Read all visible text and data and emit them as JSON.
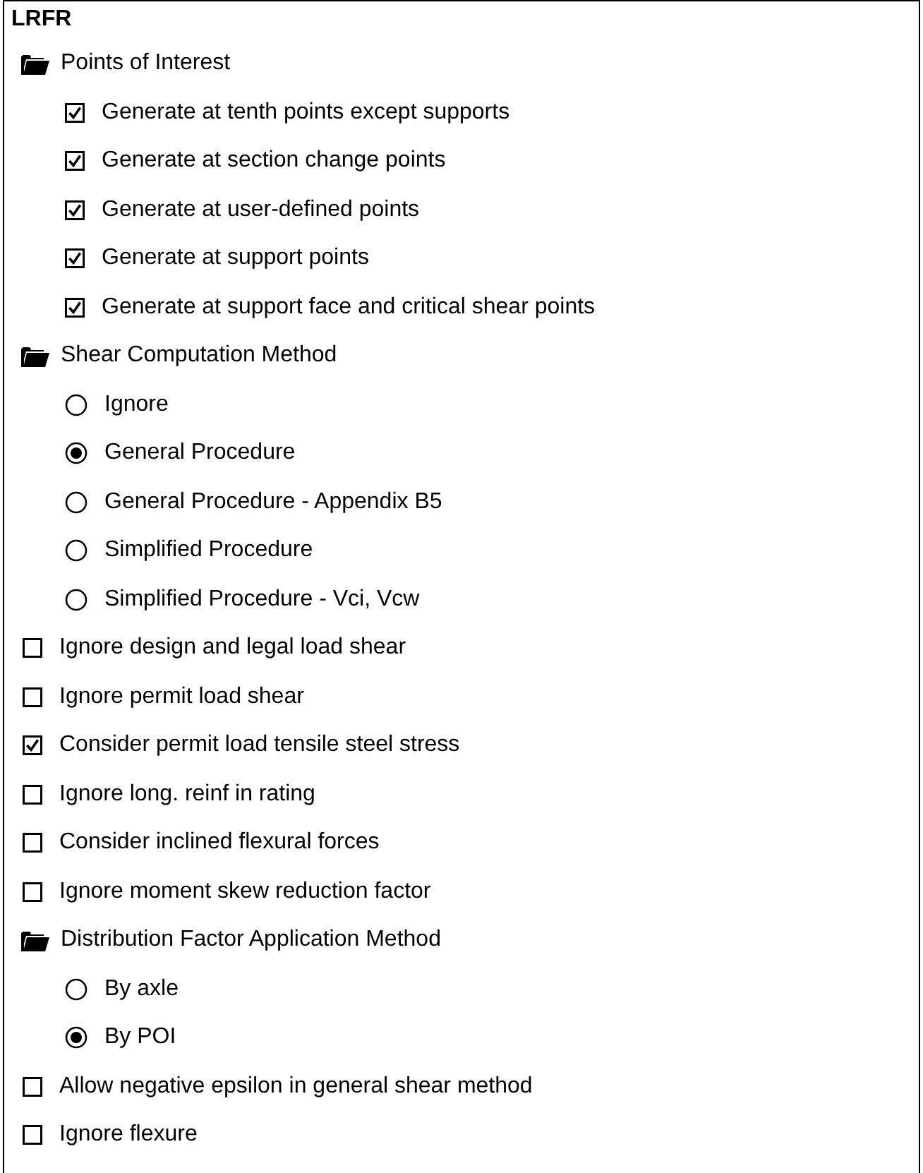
{
  "title": "LRFR",
  "items": [
    {
      "kind": "folder",
      "label": "Points of Interest",
      "children": [
        {
          "kind": "checkbox",
          "label": "Generate at tenth points except supports",
          "checked": true
        },
        {
          "kind": "checkbox",
          "label": "Generate at section change points",
          "checked": true
        },
        {
          "kind": "checkbox",
          "label": "Generate at user-defined points",
          "checked": true
        },
        {
          "kind": "checkbox",
          "label": "Generate at support points",
          "checked": true
        },
        {
          "kind": "checkbox",
          "label": "Generate at support face and critical shear points",
          "checked": true
        }
      ]
    },
    {
      "kind": "folder",
      "label": "Shear Computation Method",
      "children": [
        {
          "kind": "radio",
          "label": "Ignore",
          "selected": false
        },
        {
          "kind": "radio",
          "label": "General Procedure",
          "selected": true
        },
        {
          "kind": "radio",
          "label": "General Procedure - Appendix B5",
          "selected": false
        },
        {
          "kind": "radio",
          "label": "Simplified Procedure",
          "selected": false
        },
        {
          "kind": "radio",
          "label": "Simplified Procedure - Vci, Vcw",
          "selected": false
        }
      ]
    },
    {
      "kind": "checkbox",
      "label": "Ignore design and legal load shear",
      "checked": false
    },
    {
      "kind": "checkbox",
      "label": "Ignore permit load shear",
      "checked": false
    },
    {
      "kind": "checkbox",
      "label": "Consider permit load tensile steel stress",
      "checked": true
    },
    {
      "kind": "checkbox",
      "label": "Ignore long. reinf in rating",
      "checked": false
    },
    {
      "kind": "checkbox",
      "label": "Consider inclined flexural forces",
      "checked": false
    },
    {
      "kind": "checkbox",
      "label": "Ignore moment skew reduction factor",
      "checked": false
    },
    {
      "kind": "folder",
      "label": "Distribution Factor Application Method",
      "children": [
        {
          "kind": "radio",
          "label": "By axle",
          "selected": false
        },
        {
          "kind": "radio",
          "label": "By POI",
          "selected": true
        }
      ]
    },
    {
      "kind": "checkbox",
      "label": "Allow negative epsilon in general shear method",
      "checked": false
    },
    {
      "kind": "checkbox",
      "label": "Ignore flexure",
      "checked": false
    }
  ]
}
